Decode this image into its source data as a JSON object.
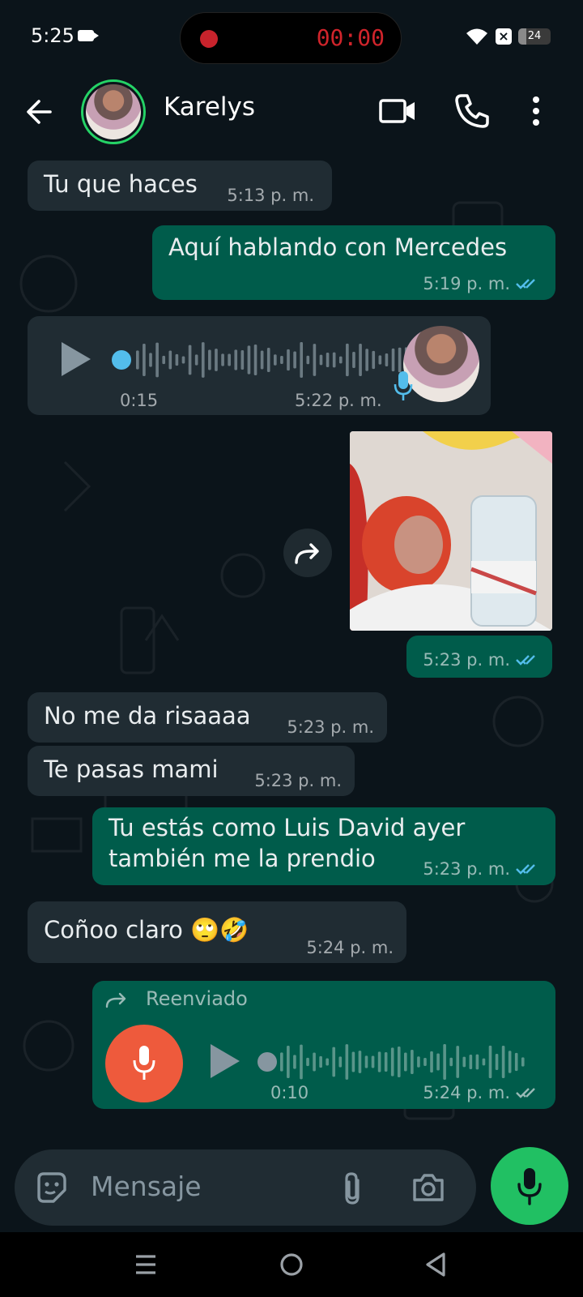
{
  "status_bar": {
    "time": "5:25",
    "recording_time": "00:00",
    "battery_level": "24",
    "battery_fraction": 0.24
  },
  "header": {
    "contact_name": "Karelys",
    "icons": [
      "back-arrow-icon",
      "video-call-icon",
      "voice-call-icon",
      "more-options-icon"
    ]
  },
  "messages": [
    {
      "type": "in",
      "text": "Tu que haces",
      "time": "5:13 p. m."
    },
    {
      "type": "out",
      "text": "Aquí hablando con Mercedes",
      "time": "5:19 p. m.",
      "read": true
    },
    {
      "type": "in-voice",
      "duration": "0:15",
      "time": "5:22 p. m.",
      "progress": 0
    },
    {
      "type": "out-image",
      "time": "5:23 p. m.",
      "read": true
    },
    {
      "type": "in",
      "text": "No me da risaaaa",
      "time": "5:23 p. m."
    },
    {
      "type": "in",
      "text": "Te pasas mami",
      "time": "5:23 p. m."
    },
    {
      "type": "out",
      "text_line1": "Tu estás como Luis David ayer",
      "text_line2": "también me la prendio",
      "time": "5:23 p. m.",
      "read": true
    },
    {
      "type": "in",
      "text": "Coñoo claro 🙄🤣",
      "time": "5:24 p. m."
    },
    {
      "type": "out-voice",
      "forwarded_label": "Reenviado",
      "duration": "0:10",
      "time": "5:24 p. m.",
      "progress": 0
    }
  ],
  "input": {
    "placeholder": "Mensaje"
  },
  "colors": {
    "background": "#0b141a",
    "incoming_bubble": "#202c33",
    "outgoing_bubble": "#005c4b",
    "accent_green": "#21c063",
    "read_ticks": "#53bdeb",
    "mic_orange": "#ee5a3c"
  }
}
